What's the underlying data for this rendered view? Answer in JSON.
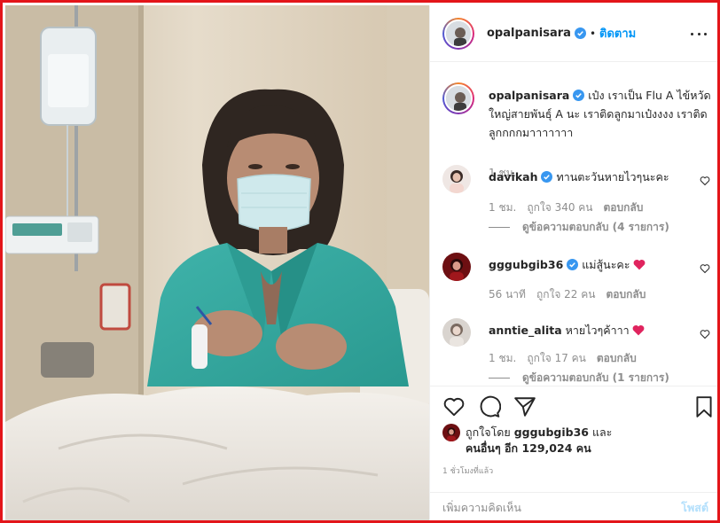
{
  "post": {
    "username": "opalpanisara",
    "follow_label": "ติดตาม",
    "dot": "•",
    "caption_user": "opalpanisara",
    "caption_text": "เป๋ง เราเป็น Flu A ไข้หวัดใหญ่สายพันธุ์ A นะ เราติดลูกมาเป๋งงงง เราติดลูกกกกมาาาาาาา",
    "caption_time": "1 ชม."
  },
  "comments": [
    {
      "user": "davikah",
      "verified": true,
      "text": "ทานตะวันหายไวๆนะคะ",
      "time": "1 ชม.",
      "likes": "ถูกใจ 340 คน",
      "reply": "ตอบกลับ",
      "view_replies": "ดูข้อความตอบกลับ (4 รายการ)"
    },
    {
      "user": "gggubgib36",
      "verified": true,
      "text": "แม่สู้นะคะ",
      "emoji": "heart",
      "time": "56 นาที",
      "likes": "ถูกใจ 22 คน",
      "reply": "ตอบกลับ"
    },
    {
      "user": "anntie_alita",
      "verified": false,
      "text": "หายไวๆค้าาา",
      "emoji": "heart",
      "time": "1 ชม.",
      "likes": "ถูกใจ 17 คน",
      "reply": "ตอบกลับ",
      "view_replies": "ดูข้อความตอบกลับ (1 รายการ)"
    }
  ],
  "likes": {
    "liked_by_prefix": "ถูกใจโดย",
    "liked_by_user": "gggubgib36",
    "and": "และ",
    "others": "คนอื่นๆ อีก 129,024 คน",
    "post_time": "1 ชั่วโมงที่แล้ว"
  },
  "add_comment": {
    "placeholder": "เพิ่มความคิดเห็น",
    "post_label": "โพสต์"
  },
  "icons": {
    "like": "heart-outline-icon",
    "comment": "comment-bubble-icon",
    "share": "share-plane-icon",
    "save": "bookmark-icon",
    "more": "more-dots-icon",
    "verified": "verified-badge-icon"
  },
  "colors": {
    "accent": "#0095f6",
    "verified": "#3897f0",
    "secondary_text": "#8e8e8e",
    "heart": "#ed4956",
    "frame_border": "#e3151a"
  }
}
